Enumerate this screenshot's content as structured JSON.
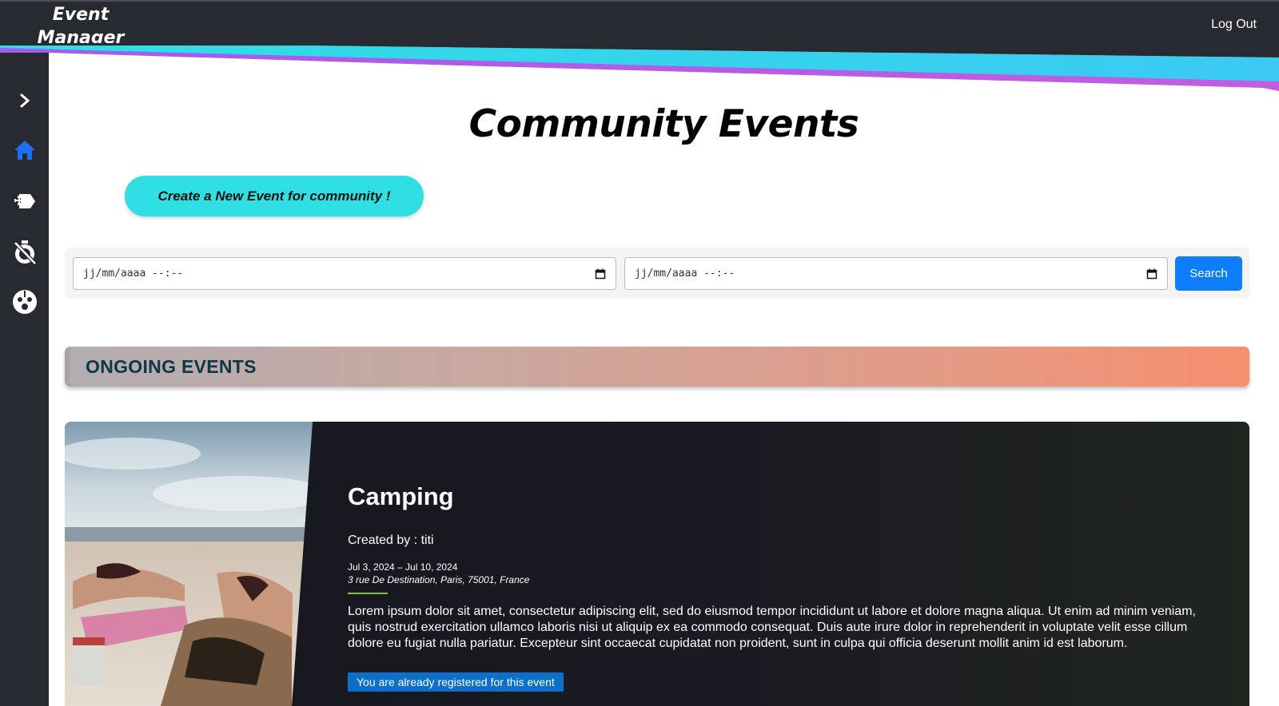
{
  "header": {
    "brand_line1": "Event",
    "brand_line2": "Manager",
    "logout_label": "Log Out"
  },
  "sidebar": {
    "items": [
      {
        "icon": "chevron-right-icon"
      },
      {
        "icon": "home-icon",
        "active": true
      },
      {
        "icon": "add-ticket-icon"
      },
      {
        "icon": "timer-off-icon"
      },
      {
        "icon": "community-icon"
      }
    ]
  },
  "page": {
    "title": "Community Events",
    "create_button": "Create a New Event for community !"
  },
  "filters": {
    "start_placeholder": "jj/mm/aaaa  --:--",
    "end_placeholder": "jj/mm/aaaa  --:--",
    "search_label": "Search"
  },
  "section": {
    "ongoing_label": "ONGOING EVENTS"
  },
  "event": {
    "title": "Camping",
    "created_by": "Created by : titi",
    "dates": "Jul 3, 2024 – Jul 10, 2024",
    "address": "3 rue De Destination, Paris, 75001, France",
    "description": "Lorem ipsum dolor sit amet, consectetur adipiscing elit, sed do eiusmod tempor incididunt ut labore et dolore magna aliqua. Ut enim ad minim veniam, quis nostrud exercitation ullamco laboris nisi ut aliquip ex ea commodo consequat. Duis aute irure dolor in reprehenderit in voluptate velit esse cillum dolore eu fugiat nulla pariatur. Excepteur sint occaecat cupidatat non proident, sunt in culpa qui officia deserunt mollit anim id est laborum.",
    "status_badge": "You are already registered for this event"
  },
  "colors": {
    "accent": "#0d7dfc",
    "create_button": "#2fdfe3",
    "sidebar": "#272a30",
    "active_icon": "#1e6ff5"
  }
}
